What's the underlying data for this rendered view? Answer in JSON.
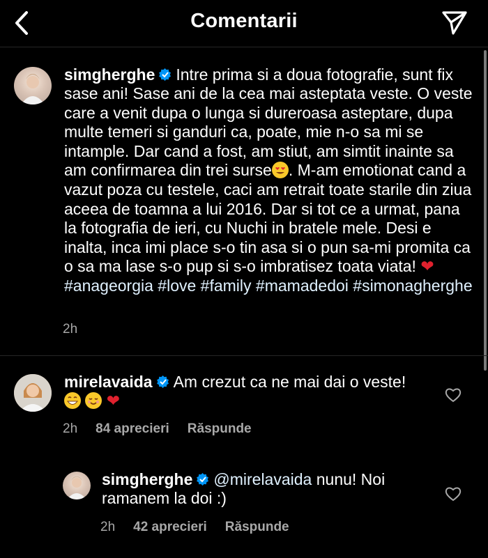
{
  "header": {
    "title": "Comentarii",
    "back_icon": "back-arrow-icon",
    "share_icon": "direct-send-icon"
  },
  "caption": {
    "username": "simgherghe",
    "text_1": "Intre prima si a doua fotografie, sunt fix sase ani! Sase ani de la cea mai asteptata veste. O veste care a venit dupa o lunga si dureroasa asteptare, dupa multe temeri si ganduri ca, poate, mie n-o sa mi se intample. Dar cand a fost, am stiut, am simtit inainte sa am confirmarea din trei surse",
    "emoji_1": "😍",
    "text_2": ". M-am emotionat cand a vazut poza cu testele, caci am retrait toate starile din ziua aceea de toamna a lui 2016. Dar si tot ce a urmat, pana la fotografia de ieri, cu Nuchi in bratele mele. Desi e inalta, inca imi place s-o tin asa si o pun sa-mi promita ca o sa ma lase s-o pup si s-o imbratisez toata viata!",
    "emoji_2": "❤",
    "hashtags": [
      "#anageorgia",
      "#love",
      "#family",
      "#mamadedoi",
      "#simonagherghe"
    ],
    "time": "2h"
  },
  "comments": [
    {
      "username": "mirelavaida",
      "text": "Am crezut ca ne mai dai o veste!",
      "emojis": [
        "😁",
        "☺",
        "❤"
      ],
      "time": "2h",
      "likes": "84 aprecieri",
      "reply_label": "Răspunde"
    }
  ],
  "replies": [
    {
      "username": "simgherghe",
      "mention": "@mirelavaida",
      "text": "nunu! Noi ramanem la doi :)",
      "time": "2h",
      "likes": "42 aprecieri",
      "reply_label": "Răspunde"
    }
  ],
  "colors": {
    "background": "#000000",
    "text": "#ffffff",
    "secondary": "#a8a8a8",
    "verified": "#0095f6",
    "heart": "#e0212e"
  }
}
